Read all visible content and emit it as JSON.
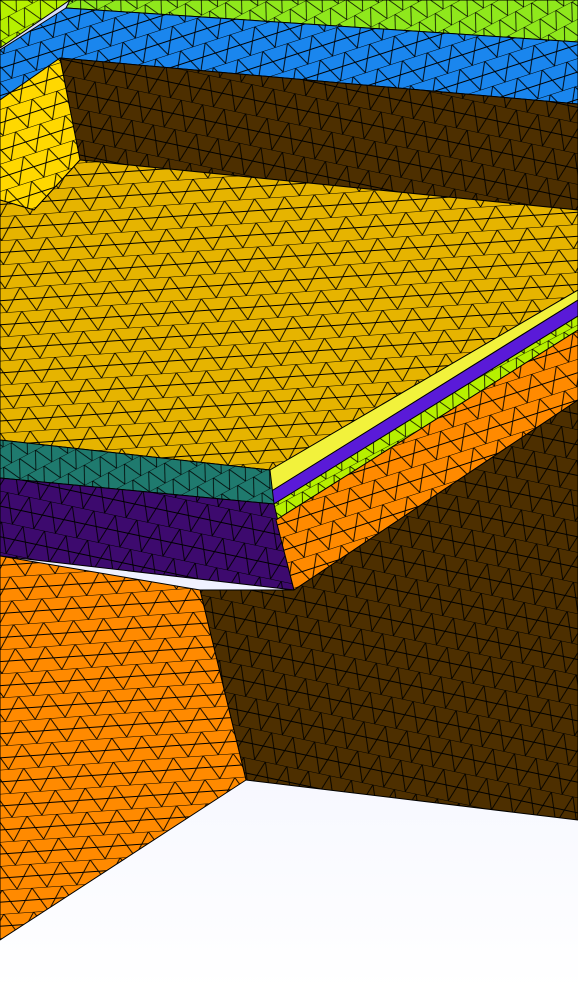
{
  "scene": {
    "background": [
      "#d6dcfb",
      "#ffffff"
    ],
    "mesh_edge_color": "#000000",
    "materials": {
      "yellow_plate": "#e6b400",
      "yellow_bright": "#ffd800",
      "brown_wall": "#4d2f00",
      "orange_block": "#ff8a00",
      "blue_band": "#1a86ee",
      "green_band": "#8fe81c",
      "lime_band": "#b6f000",
      "purple_layer": "#3d0a6e",
      "indigo_stripe": "#5a1ad8",
      "teal_layer": "#1f7a6e",
      "pale_yellow": "#f2f23c"
    }
  }
}
